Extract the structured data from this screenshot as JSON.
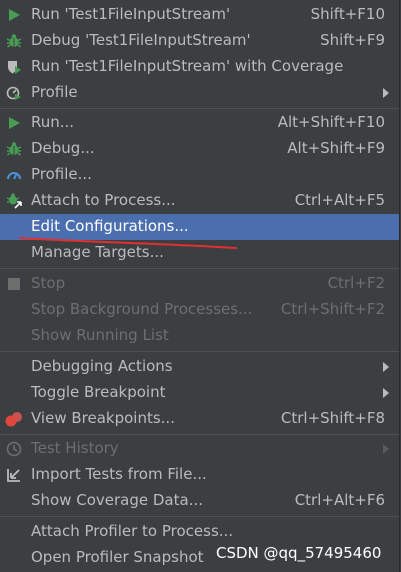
{
  "menu": {
    "run_class": {
      "label": "Run 'Test1FileInputStream'",
      "shortcut": "Shift+F10"
    },
    "debug_class": {
      "label": "Debug 'Test1FileInputStream'",
      "shortcut": "Shift+F9"
    },
    "coverage_class": {
      "label": "Run 'Test1FileInputStream' with Coverage"
    },
    "profile_class": {
      "label": "Profile"
    },
    "run": {
      "label": "Run...",
      "shortcut": "Alt+Shift+F10"
    },
    "debug": {
      "label": "Debug...",
      "shortcut": "Alt+Shift+F9"
    },
    "profile": {
      "label": "Profile..."
    },
    "attach": {
      "label": "Attach to Process...",
      "shortcut": "Ctrl+Alt+F5"
    },
    "edit_config": {
      "label": "Edit Configurations..."
    },
    "manage_targets": {
      "label": "Manage Targets..."
    },
    "stop": {
      "label": "Stop",
      "shortcut": "Ctrl+F2"
    },
    "stop_background": {
      "label": "Stop Background Processes...",
      "shortcut": "Ctrl+Shift+F2"
    },
    "show_running": {
      "label": "Show Running List"
    },
    "debugging_actions": {
      "label": "Debugging Actions"
    },
    "toggle_breakpoint": {
      "label": "Toggle Breakpoint"
    },
    "view_breakpoints": {
      "label": "View Breakpoints...",
      "shortcut": "Ctrl+Shift+F8"
    },
    "test_history": {
      "label": "Test History"
    },
    "import_tests": {
      "label": "Import Tests from File..."
    },
    "show_coverage": {
      "label": "Show Coverage Data...",
      "shortcut": "Ctrl+Alt+F6"
    },
    "attach_profiler": {
      "label": "Attach Profiler to Process..."
    },
    "open_snapshot": {
      "label": "Open Profiler Snapshot"
    }
  },
  "watermark": "CSDN @qq_57495460",
  "colors": {
    "background": "#3c3f41",
    "selected": "#4b6eaf",
    "text": "#bbbbbb",
    "disabled_text": "#6e6e6e",
    "run_green": "#499c54",
    "annotation_red": "#e03030"
  }
}
